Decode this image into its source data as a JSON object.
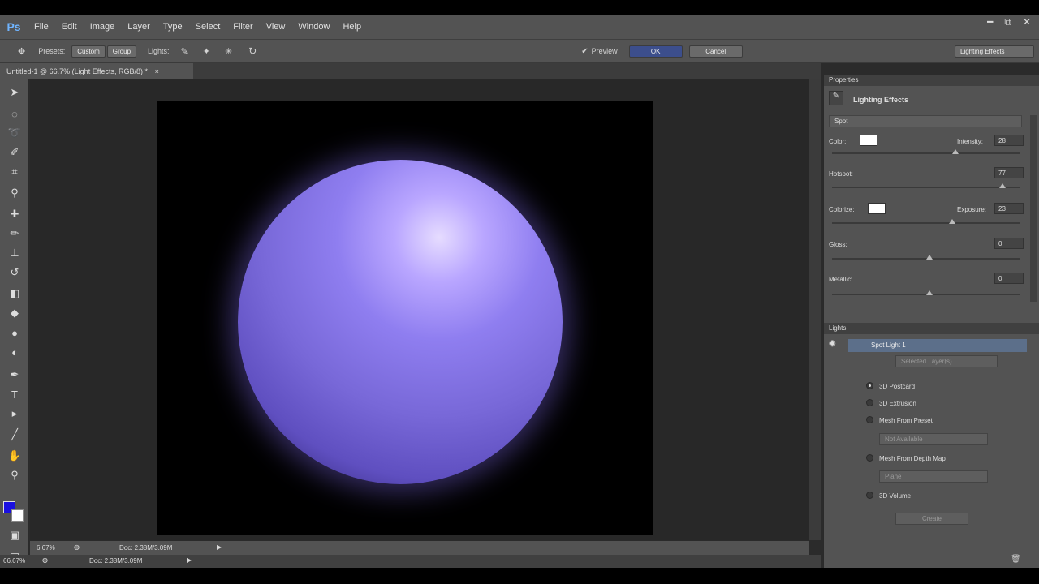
{
  "app": {
    "logo": "Ps"
  },
  "menu": [
    "File",
    "Edit",
    "Image",
    "Layer",
    "Type",
    "Select",
    "Filter",
    "View",
    "Window",
    "Help"
  ],
  "window_controls": {
    "minimize": "━",
    "restore": "⧉",
    "close": "✕"
  },
  "options_bar": {
    "presets_label": "Presets:",
    "presets_value": "Custom",
    "group_value": "Group",
    "lights_label": "Lights:",
    "preview_label": "Preview",
    "ok_label": "OK",
    "cancel_label": "Cancel",
    "workspace_value": "Lighting Effects"
  },
  "document_tab": {
    "title": "Untitled-1 @ 66.7% (Light Effects, RGB/8) *",
    "close": "×"
  },
  "status": {
    "zoom": "6.67%",
    "doc_info": "Doc: 2.38M/3.09M",
    "zoom_bottom": "66.67%",
    "doc_info_bottom": "Doc: 2.38M/3.09M"
  },
  "properties": {
    "header": "Properties",
    "title": "Lighting Effects",
    "light_type": "Spot",
    "color_label": "Color:",
    "intensity_label": "Intensity:",
    "intensity": "28",
    "hotspot_label": "Hotspot:",
    "hotspot": "77",
    "colorize_label": "Colorize:",
    "exposure_label": "Exposure:",
    "exposure": "23",
    "gloss_label": "Gloss:",
    "gloss": "0",
    "metallic_label": "Metallic:",
    "metallic": "0",
    "intensity_level": 0.64,
    "hotspot_level": 0.89,
    "exposure_level": 0.62,
    "gloss_level": 0.5,
    "metallic_level": 0.5
  },
  "lights": {
    "header": "Lights",
    "item": "Spot Light 1",
    "layer_dropdown": "Selected Layer(s)",
    "options": [
      "3D Postcard",
      "3D Extrusion",
      "Mesh From Preset",
      "Mesh From Depth Map",
      "3D Volume"
    ],
    "preset_dropdown": "Not Available",
    "depth_dropdown": "Plane",
    "create_label": "Create"
  },
  "colors": {
    "foreground": "#1a10e0",
    "background": "#ffffff"
  }
}
